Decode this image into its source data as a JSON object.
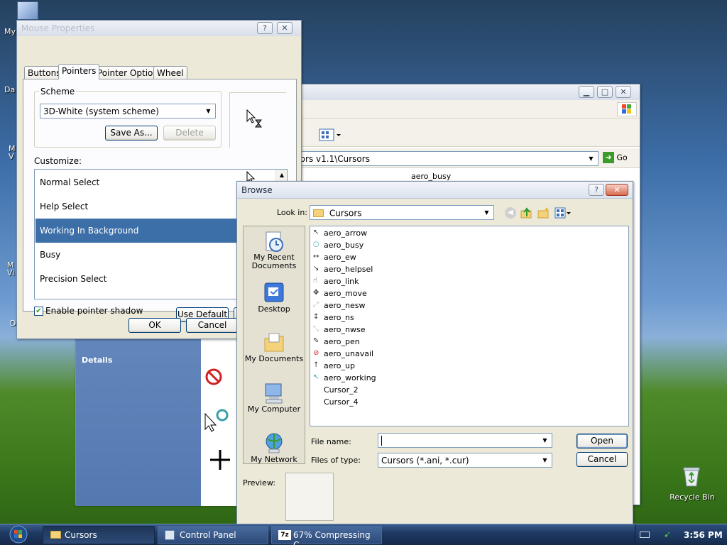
{
  "desktop": {
    "icons_partial": [
      "My",
      "Da",
      "M\nV",
      "M\nVi",
      "D"
    ],
    "recycle_bin": "Recycle Bin"
  },
  "mouse_properties": {
    "title": "Mouse Properties",
    "tabs": [
      "Buttons",
      "Pointers",
      "Pointer Options",
      "Wheel"
    ],
    "scheme_label": "Scheme",
    "scheme_value": "3D-White (system scheme)",
    "save_as": "Save As...",
    "delete": "Delete",
    "customize_label": "Customize:",
    "items": [
      "Normal Select",
      "Help Select",
      "Working In Background",
      "Busy",
      "Precision Select"
    ],
    "shadow_label": "Enable pointer shadow",
    "use_default": "Use Default",
    "ok": "OK",
    "cancel": "Cancel"
  },
  "explorer": {
    "address": "olors v1.1\\Cursors",
    "go": "Go",
    "first_file": "aero_busy",
    "details": "Details"
  },
  "browse": {
    "title": "Browse",
    "look_in_label": "Look in:",
    "look_in_value": "Cursors",
    "places": [
      "My Recent Documents",
      "Desktop",
      "My Documents",
      "My Computer",
      "My Network"
    ],
    "files": [
      "aero_arrow",
      "aero_busy",
      "aero_ew",
      "aero_helpsel",
      "aero_link",
      "aero_move",
      "aero_nesw",
      "aero_ns",
      "aero_nwse",
      "aero_pen",
      "aero_unavail",
      "aero_up",
      "aero_working",
      "Cursor_2",
      "Cursor_4"
    ],
    "file_name_label": "File name:",
    "file_name_value": "",
    "files_of_type_label": "Files of type:",
    "files_of_type_value": "Cursors (*.ani, *.cur)",
    "open": "Open",
    "cancel": "Cancel",
    "preview_label": "Preview:"
  },
  "taskbar": {
    "tasks": [
      "Cursors",
      "Control Panel",
      "67% Compressing C..."
    ],
    "clock": "3:56 PM"
  }
}
